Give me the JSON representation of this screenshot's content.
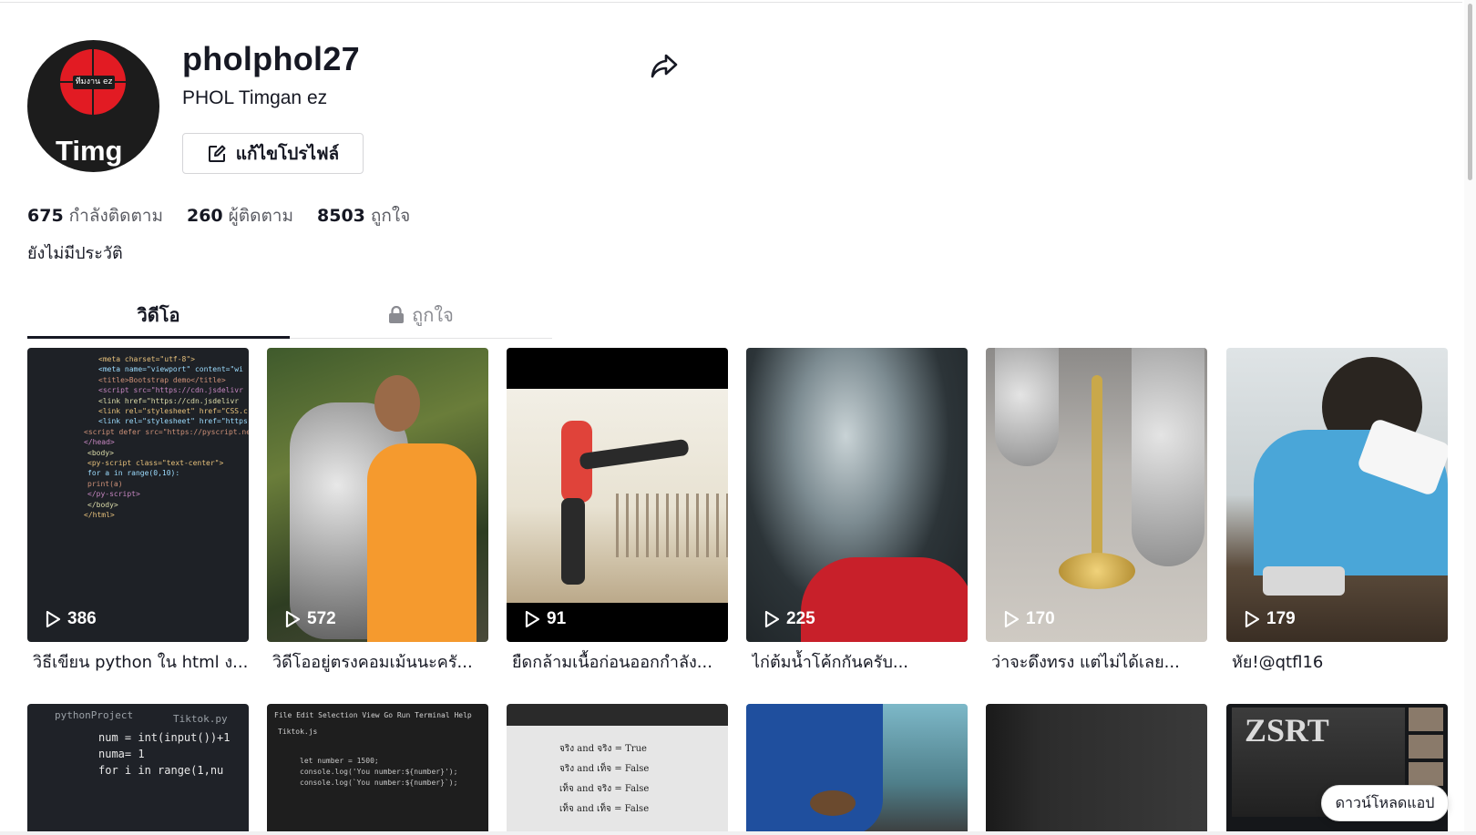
{
  "profile": {
    "username": "pholphol27",
    "nickname": "PHOL Timgan ez",
    "avatar_badge": "ทีมงาน ez",
    "avatar_text": "L Timg",
    "edit_label": "แก้ไขโปรไฟล์",
    "stats": [
      {
        "value": "675",
        "label": "กำลังติดตาม"
      },
      {
        "value": "260",
        "label": "ผู้ติดตาม"
      },
      {
        "value": "8503",
        "label": "ถูกใจ"
      }
    ],
    "bio": "ยังไม่มีประวัติ"
  },
  "tabs": {
    "videos": "วิดีโอ",
    "liked": "ถูกใจ"
  },
  "videos": [
    {
      "views": "386",
      "caption": "วิธีเขียน python ใน html ง..."
    },
    {
      "views": "572",
      "caption": "วิดีโออยู่ตรงคอมเม้นนะครั..."
    },
    {
      "views": "91",
      "caption": "ยืดกล้ามเนื้อก่อนออกกำลัง..."
    },
    {
      "views": "225",
      "caption": "ไก่ต้มน้ำโค้กกันครับ..."
    },
    {
      "views": "170",
      "caption": "ว่าจะดึงทรง แต่ไม่ได้เลย..."
    },
    {
      "views": "179",
      "caption": "หัย!@qtfl16"
    }
  ],
  "row2_thumbs": {
    "code1": [
      "pythonProject",
      "Tiktok.py",
      "num = int(input())+1",
      "numa= 1",
      "for i in range(1,nu"
    ],
    "code2": [
      "File  Edit  Selection  View  Go  Run  Terminal  Help",
      "Tiktok.js",
      "let number = 1500;",
      "console.log('You number:${number}');",
      "console.log(`You number:${number}`);"
    ],
    "truth": [
      "จริง and จริง = True",
      "จริง and เท็จ = False",
      "เท็จ and จริง = False",
      "เท็จ and เท็จ = False"
    ],
    "poster": "ZSRT"
  },
  "thumb_texts": {
    "code": [
      "<meta charset=\"utf-8\">",
      "<meta name=\"viewport\" content=\"wi",
      "<title>Bootstrap demo</title>",
      "<script src=\"https://cdn.jsdelivr",
      "<link href=\"https://cdn.jsdelivr",
      "<link rel=\"stylesheet\" href=\"CSS.c",
      "<link rel=\"stylesheet\" href=\"https",
      "<script defer src=\"https://pyscript.ne",
      "</head>",
      "<body>",
      "<py-script class=\"text-center\">",
      "for a in range(0,10):",
      "print(a)",
      "</py-script>",
      "</body>",
      "</html>"
    ]
  },
  "download_label": "ดาวน์โหลดแอป",
  "colors": {
    "text": "#161823",
    "muted": "#8a8b91",
    "avatar_red": "#e21b23"
  }
}
